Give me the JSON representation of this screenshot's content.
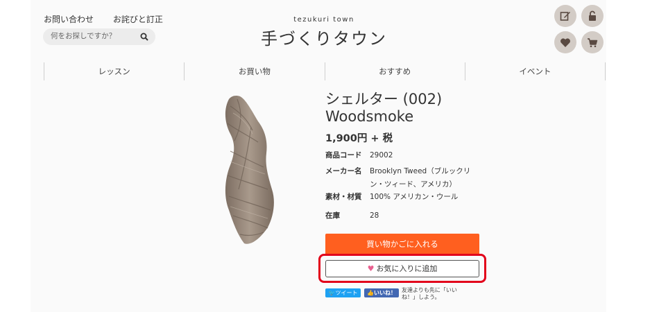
{
  "header": {
    "links": [
      "お問い合わせ",
      "お詫びと訂正"
    ],
    "search_placeholder": "何をお探しですか？",
    "brand_sub": "tezukuri town",
    "brand_title": "手づくりタウン",
    "icons": [
      "edit-icon",
      "unlock-icon",
      "heart-icon",
      "cart-icon"
    ]
  },
  "nav": [
    "レッスン",
    "お買い物",
    "おすすめ",
    "イベント"
  ],
  "product": {
    "title_line1": "シェルター (002)",
    "title_line2": "Woodsmoke",
    "price": "1,900円 + 税",
    "specs": [
      {
        "key": "商品コード",
        "value": "29002"
      },
      {
        "key": "メーカー名",
        "value": "Brooklyn Tweed（ブルックリン・ツィード、アメリカ）"
      },
      {
        "key": "素材・材質",
        "value": "100% アメリカン・ウール"
      },
      {
        "key": "在庫",
        "value": "28"
      }
    ],
    "cart_button": "買い物かごに入れる",
    "favorite_button": "お気に入りに追加"
  },
  "social": {
    "tweet": "ツイート",
    "like": "いいね！",
    "like_note": "友達よりも先に「いいね！」しよう。"
  },
  "colors": {
    "accent_orange": "#ff5f1f",
    "highlight_red": "#e2001a",
    "icon_circle": "#d3ccc6",
    "icon_dark": "#5a4a42"
  }
}
